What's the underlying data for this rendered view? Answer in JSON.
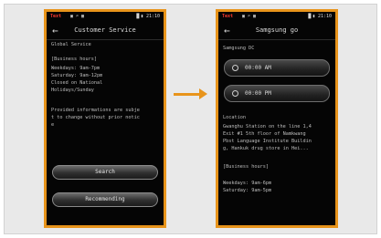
{
  "accent_color": "#e8941b",
  "left_screen": {
    "status": {
      "carrier": "Text",
      "icons": "▣ ⌕ ▦",
      "time": "▐▌▮ 21:10"
    },
    "back_icon": "back-arrow-icon",
    "title": "Customer Service",
    "top_text": "Global Service",
    "business_hours_header": "[Business hours]",
    "hours": [
      "Weekdays: 9am-7pm",
      "Saturday: 9am-12pm",
      "Closed on National",
      "Holidays/Sunday"
    ],
    "notice": [
      "Provided informations are subje",
      "t to change without prior notic",
      "e"
    ],
    "buttons": [
      "Search",
      "Recommending"
    ]
  },
  "right_screen": {
    "status": {
      "carrier": "Text",
      "icons": "▣ ⌕ ▦",
      "time": "▐▌▮ 21:10"
    },
    "back_icon": "back-arrow-icon",
    "title": "Samgsung go",
    "section": "Samgsung DC",
    "time_fields": [
      "00:00 AM",
      "00:00 PM"
    ],
    "location_header": "Location",
    "location_text": [
      "Gwanghu Station on the line 1,4",
      "Exit #1 5th floor of Namkwang",
      "Pbst Language Institute Buildin",
      "g, Hankuk drug store in Hei..."
    ],
    "business_hours_header": "[Business hours]",
    "hours": [
      "Weekdays: 9am-6pm",
      "Saturday: 9am-5pm"
    ]
  }
}
